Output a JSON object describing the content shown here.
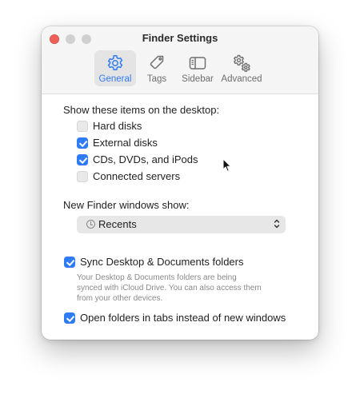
{
  "window": {
    "title": "Finder Settings"
  },
  "tabs": [
    {
      "label": "General",
      "icon": "gear-icon",
      "active": true
    },
    {
      "label": "Tags",
      "icon": "tag-icon",
      "active": false
    },
    {
      "label": "Sidebar",
      "icon": "sidebar-icon",
      "active": false
    },
    {
      "label": "Advanced",
      "icon": "gears-icon",
      "active": false
    }
  ],
  "desktop": {
    "heading": "Show these items on the desktop:",
    "items": [
      {
        "label": "Hard disks",
        "checked": false
      },
      {
        "label": "External disks",
        "checked": true
      },
      {
        "label": "CDs, DVDs, and iPods",
        "checked": true
      },
      {
        "label": "Connected servers",
        "checked": false
      }
    ]
  },
  "new_window": {
    "heading": "New Finder windows show:",
    "selected": "Recents",
    "icon": "clock-icon"
  },
  "sync": {
    "label": "Sync Desktop & Documents folders",
    "checked": true,
    "help_line1": "Your Desktop & Documents folders are being",
    "help_line2": "synced with iCloud Drive. You can also access them",
    "help_line3": "from your other devices."
  },
  "tabs_option": {
    "label": "Open folders in tabs instead of new windows",
    "checked": true
  },
  "colors": {
    "accent": "#2f7bf5",
    "close_button": "#ee5f57",
    "inactive_button": "#d0d0d0"
  }
}
